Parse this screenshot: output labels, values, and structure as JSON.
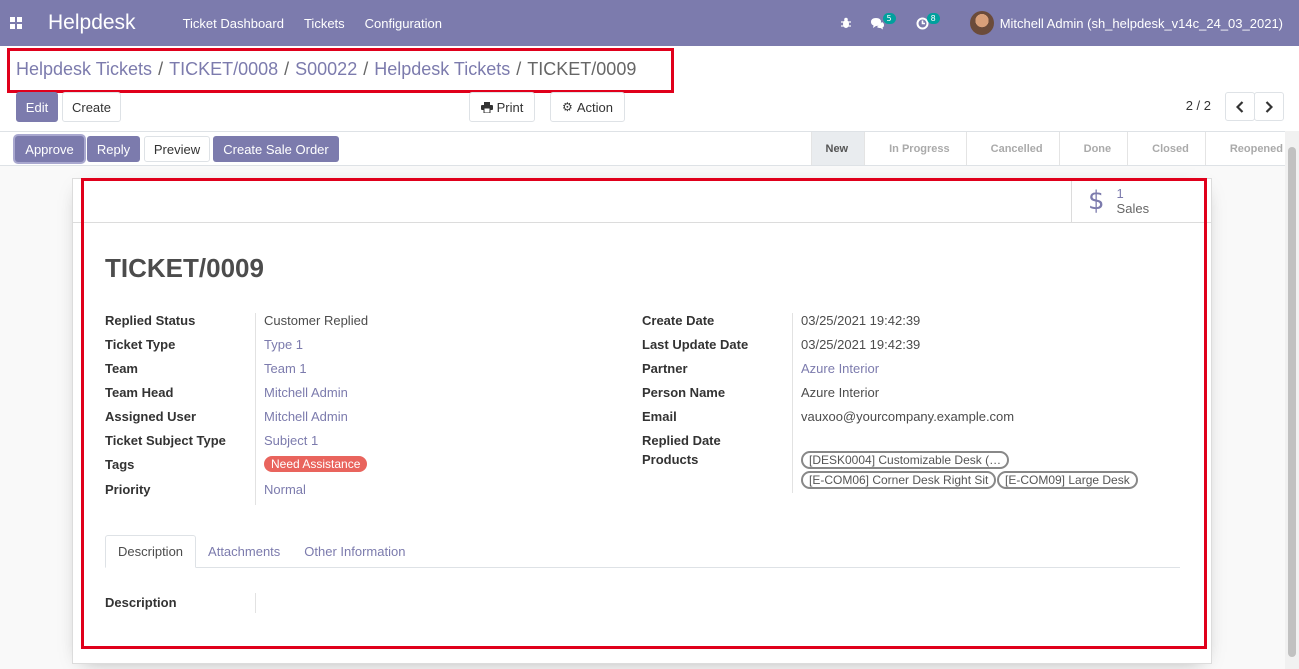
{
  "navbar": {
    "brand": "Helpdesk",
    "menu": [
      "Ticket Dashboard",
      "Tickets",
      "Configuration"
    ],
    "chat_badge": "5",
    "activity_badge": "8",
    "user": "Mitchell Admin (sh_helpdesk_v14c_24_03_2021)"
  },
  "breadcrumb": [
    "Helpdesk Tickets",
    "TICKET/0008",
    "S00022",
    "Helpdesk Tickets",
    "TICKET/0009"
  ],
  "control": {
    "edit": "Edit",
    "create": "Create",
    "print": "Print",
    "action": "Action",
    "pager": "2 / 2"
  },
  "statusbar": {
    "approve": "Approve",
    "reply": "Reply",
    "preview": "Preview",
    "create_sale_order": "Create Sale Order",
    "stages": [
      "New",
      "In Progress",
      "Cancelled",
      "Done",
      "Closed",
      "Reopened"
    ],
    "active_stage": "New"
  },
  "sheet": {
    "sales_count": "1",
    "sales_label": "Sales",
    "title": "TICKET/0009",
    "left_fields": [
      {
        "label": "Replied Status",
        "value": "Customer Replied"
      },
      {
        "label": "Ticket Type",
        "value": "Type 1"
      },
      {
        "label": "Team",
        "value": "Team 1"
      },
      {
        "label": "Team Head",
        "value": "Mitchell Admin"
      },
      {
        "label": "Assigned User",
        "value": "Mitchell Admin"
      },
      {
        "label": "Ticket Subject Type",
        "value": "Subject 1"
      },
      {
        "label": "Tags",
        "value": "Need Assistance"
      },
      {
        "label": "Priority",
        "value": "Normal"
      }
    ],
    "right_fields": [
      {
        "label": "Create Date",
        "value": "03/25/2021 19:42:39"
      },
      {
        "label": "Last Update Date",
        "value": "03/25/2021 19:42:39"
      },
      {
        "label": "Partner",
        "value": "Azure Interior"
      },
      {
        "label": "Person Name",
        "value": "Azure Interior"
      },
      {
        "label": "Email",
        "value": "vauxoo@yourcompany.example.com"
      },
      {
        "label": "Replied Date",
        "value": ""
      },
      {
        "label": "Products",
        "value": ""
      }
    ],
    "products": [
      "[DESK0004] Customizable Desk (…",
      "[E-COM06] Corner Desk Right Sit",
      "[E-COM09] Large Desk"
    ],
    "tabs": [
      "Description",
      "Attachments",
      "Other Information"
    ],
    "description_label": "Description"
  },
  "colors": {
    "brand": "#7c7bad",
    "tag_red": "#e9645d",
    "highlight_red": "#e0001b"
  }
}
